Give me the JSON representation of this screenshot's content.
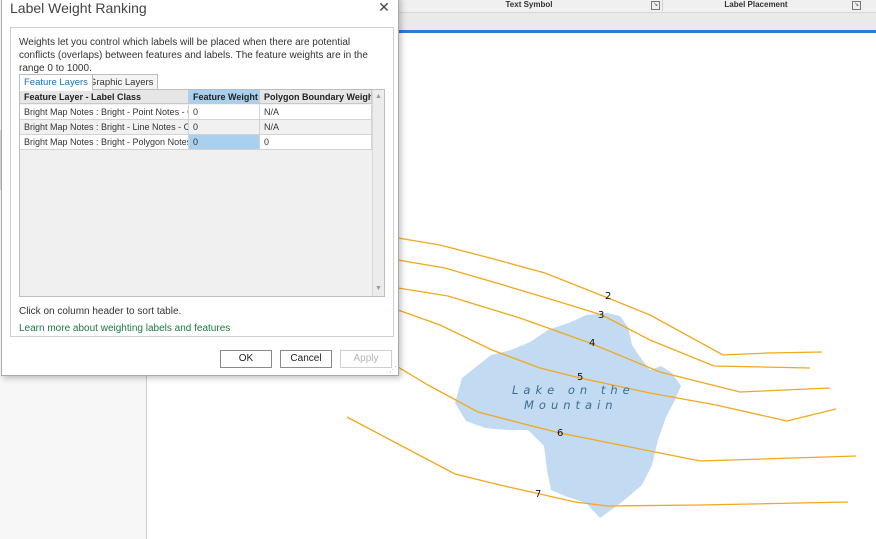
{
  "ribbon": {
    "groups": [
      {
        "label": "Text Symbol"
      },
      {
        "label": "Label Placement"
      }
    ]
  },
  "dialog": {
    "title": "Label Weight Ranking",
    "description": "Weights let you control which labels will be placed when there are potential conflicts (overlaps) between features and labels. The feature weights are in the range 0 to 1000.",
    "tabs": [
      {
        "label": "Feature Layers",
        "active": true
      },
      {
        "label": "Graphic Layers",
        "active": false
      }
    ],
    "table": {
      "columns": [
        "Feature Layer - Label Class",
        "Feature Weight",
        "Polygon Boundary Weight"
      ],
      "rows": [
        {
          "label_class": "Bright Map Notes : Bright - Point Notes - Cl",
          "feature_weight": "0",
          "polygon_boundary_weight": "N/A"
        },
        {
          "label_class": "Bright Map Notes : Bright - Line Notes - Cla",
          "feature_weight": "0",
          "polygon_boundary_weight": "N/A"
        },
        {
          "label_class": "Bright Map Notes : Bright - Polygon Notes -",
          "feature_weight": "0",
          "polygon_boundary_weight": "0"
        }
      ]
    },
    "hint": "Click on column header to sort table.",
    "learn_more": "Learn more about weighting labels and features",
    "buttons": {
      "ok": "OK",
      "cancel": "Cancel",
      "apply": "Apply"
    }
  },
  "map": {
    "lake_label_line1": "Lake on the",
    "lake_label_line2": "Mountain",
    "contour_labels": [
      "2",
      "3",
      "4",
      "5",
      "6",
      "7"
    ],
    "colors": {
      "contour": "#f2a81d",
      "lake_fill": "#c2dbf2",
      "lake_text": "#3a6e8f"
    }
  },
  "colors": {
    "accent": "#2e7dc6",
    "selected_cell": "#a8d1ef",
    "link": "#1a7a3e"
  }
}
